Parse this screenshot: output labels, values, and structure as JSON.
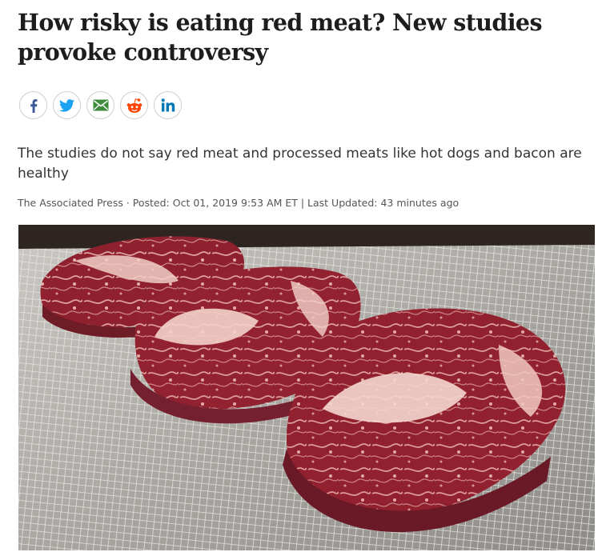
{
  "article": {
    "headline": "How risky is eating red meat? New studies provoke controversy",
    "deck": "The studies do not say red meat and processed meats like hot dogs and bacon are healthy",
    "byline": {
      "author": "The Associated Press",
      "separator": " · ",
      "posted_label": "Posted: ",
      "posted_value": "Oct 01, 2019 9:53 AM ET",
      "divider": " | ",
      "updated_label": "Last Updated: ",
      "updated_value": "43 minutes ago"
    }
  },
  "share": {
    "buttons": [
      {
        "name": "facebook",
        "icon": "facebook-icon",
        "color": "#3b5998"
      },
      {
        "name": "twitter",
        "icon": "twitter-icon",
        "color": "#1da1f2"
      },
      {
        "name": "email",
        "icon": "email-icon",
        "color": "#3e8b3c"
      },
      {
        "name": "reddit",
        "icon": "reddit-icon",
        "color": "#ff4500"
      },
      {
        "name": "linkedin",
        "icon": "linkedin-icon",
        "color": "#0077b5"
      }
    ]
  },
  "photo": {
    "subject": "three raw ribeye steaks on a wire cooling rack"
  }
}
